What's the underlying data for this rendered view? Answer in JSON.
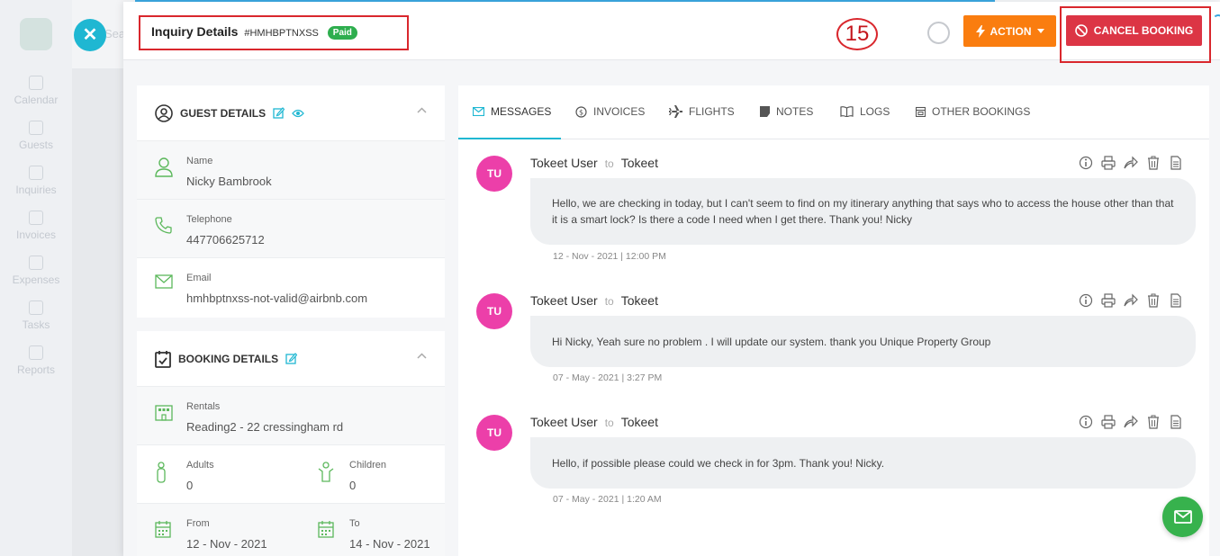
{
  "background": {
    "search_placeholder": "Sea",
    "nav": [
      {
        "label": "Calendar",
        "icon": "calendar-icon"
      },
      {
        "label": "Guests",
        "icon": "guests-icon"
      },
      {
        "label": "Inquiries",
        "icon": "inquiries-icon"
      },
      {
        "label": "Invoices",
        "icon": "invoices-icon"
      },
      {
        "label": "Expenses",
        "icon": "expenses-icon"
      },
      {
        "label": "Tasks",
        "icon": "tasks-icon"
      },
      {
        "label": "Reports",
        "icon": "reports-icon"
      }
    ]
  },
  "header": {
    "title": "Inquiry Details",
    "code": "#HMHBPTNXSS",
    "status_badge": "Paid",
    "step_number": "15",
    "action_label": "ACTION",
    "cancel_label": "CANCEL BOOKING"
  },
  "guest_details": {
    "title": "GUEST DETAILS",
    "name_label": "Name",
    "name": "Nicky Bambrook",
    "phone_label": "Telephone",
    "phone": "447706625712",
    "email_label": "Email",
    "email": "hmhbptnxss-not-valid@airbnb.com"
  },
  "booking_details": {
    "title": "BOOKING DETAILS",
    "rentals_label": "Rentals",
    "rental": "Reading2 - 22 cressingham rd",
    "adults_label": "Adults",
    "adults": "0",
    "children_label": "Children",
    "children": "0",
    "from_label": "From",
    "from": "12 - Nov - 2021",
    "to_label": "To",
    "to": "14 - Nov - 2021"
  },
  "tabs": [
    {
      "label": "MESSAGES",
      "icon": "envelope-icon"
    },
    {
      "label": "INVOICES",
      "icon": "dollar-icon"
    },
    {
      "label": "FLIGHTS",
      "icon": "plane-icon"
    },
    {
      "label": "NOTES",
      "icon": "note-icon"
    },
    {
      "label": "LOGS",
      "icon": "book-icon"
    },
    {
      "label": "OTHER BOOKINGS",
      "icon": "calendar-icon"
    }
  ],
  "messages": [
    {
      "initials": "TU",
      "from": "Tokeet User",
      "to_word": "to",
      "to": "Tokeet",
      "text": "Hello, we are checking in today, but I can't seem to find on my itinerary anything that says who to access the house other than that it is a smart lock? Is there a code I need when I get there. Thank you! Nicky",
      "time": "12 - Nov - 2021 | 12:00 PM"
    },
    {
      "initials": "TU",
      "from": "Tokeet User",
      "to_word": "to",
      "to": "Tokeet",
      "text": "Hi Nicky, Yeah sure no problem . I will update our system. thank you Unique Property Group",
      "time": "07 - May - 2021 | 3:27 PM"
    },
    {
      "initials": "TU",
      "from": "Tokeet User",
      "to_word": "to",
      "to": "Tokeet",
      "text": "Hello, if possible please could we check in for 3pm. Thank you! Nicky.",
      "time": "07 - May - 2021 | 1:20 AM"
    }
  ],
  "colors": {
    "accent": "#1fb7d2",
    "action": "#fa7d0f",
    "cancel": "#dc3545",
    "avatar": "#ec3fa9",
    "paid": "#2eae4e",
    "annotation": "#d9272d"
  }
}
